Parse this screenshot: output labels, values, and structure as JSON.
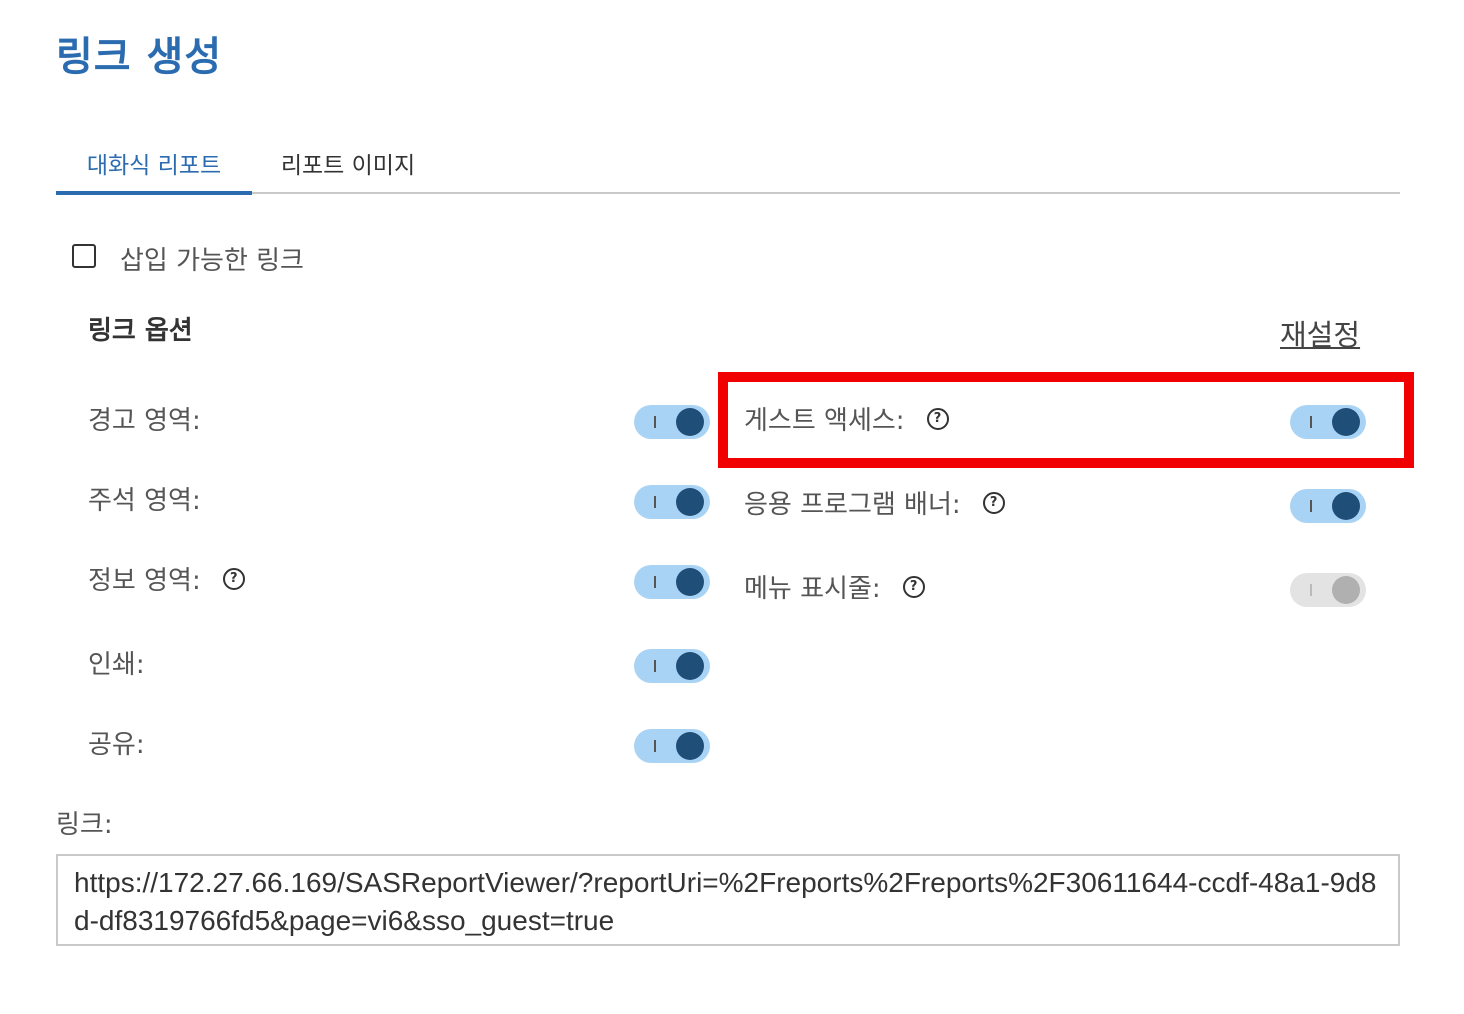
{
  "dialog": {
    "title": "링크 생성"
  },
  "tabs": [
    {
      "label": "대화식 리포트",
      "active": true
    },
    {
      "label": "리포트 이미지",
      "active": false
    }
  ],
  "embed": {
    "label": "삽입 가능한 링크",
    "checked": false
  },
  "options": {
    "title": "링크 옵션",
    "reset_label": "재설정",
    "left": [
      {
        "label": "경고 영역:",
        "on": true,
        "help": false
      },
      {
        "label": "주석 영역:",
        "on": true,
        "help": false
      },
      {
        "label": "정보 영역:",
        "on": true,
        "help": true
      },
      {
        "label": "인쇄:",
        "on": true,
        "help": false
      },
      {
        "label": "공유:",
        "on": true,
        "help": false
      }
    ],
    "right": [
      {
        "label": "게스트 액세스:",
        "on": true,
        "help": true,
        "highlighted": true
      },
      {
        "label": "응용 프로그램 배너:",
        "on": true,
        "help": true
      },
      {
        "label": "메뉴 표시줄:",
        "on": true,
        "help": true,
        "disabled": true
      }
    ]
  },
  "link": {
    "label": "링크:",
    "value": "https://172.27.66.169/SASReportViewer/?reportUri=%2Freports%2Freports%2F30611644-ccdf-48a1-9d8d-df8319766fd5&page=vi6&sso_guest=true"
  },
  "colors": {
    "accent": "#2b6cb0",
    "toggle_track": "#a9d3f5",
    "toggle_knob": "#1f4e79",
    "highlight": "#f00000"
  },
  "icons": {
    "help": "question-circle-icon"
  }
}
